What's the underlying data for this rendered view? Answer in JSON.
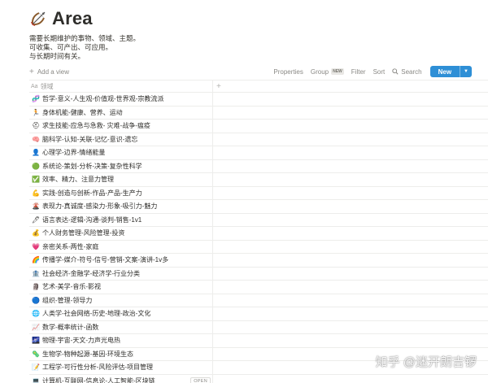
{
  "page": {
    "title": "Area",
    "title_icon": "bow-and-arrow-icon",
    "description": [
      "需要长期维护的事物、领域、主题。",
      "可收集、可产出、可应用。",
      "与长期时间有关。"
    ]
  },
  "toolbar": {
    "add_view": "Add a view",
    "properties": "Properties",
    "group": "Group",
    "group_badge": "NEW",
    "filter": "Filter",
    "sort": "Sort",
    "search": "Search",
    "new_label": "New",
    "accent": "#2e8fd6"
  },
  "table": {
    "column_header": "领域",
    "add_column": "+",
    "open_label": "OPEN",
    "rows": [
      {
        "icon": "🧬",
        "label": "哲学-意义-人生观-价值观-世界观-宗教流派"
      },
      {
        "icon": "🏃",
        "label": "身体机能-健康、营养、运动"
      },
      {
        "icon": "⛑",
        "label": "求生技能-应急与急救- 灾难-战争-瘟疫"
      },
      {
        "icon": "🧠",
        "label": "脑科学-认知-关联-记忆-意识-遗忘"
      },
      {
        "icon": "👤",
        "label": "心理学-边界-情绪能量"
      },
      {
        "icon": "🟢",
        "label": "系统论-策划-分析-决策-复杂性科学"
      },
      {
        "icon": "✅",
        "label": "效率、精力、注意力管理"
      },
      {
        "icon": "💪",
        "label": "实践-创造与创新-作品-产品-生产力"
      },
      {
        "icon": "🌋",
        "label": "表现力-真诚度-感染力-形象-吸引力-魅力"
      },
      {
        "icon": "🖊",
        "label": "语言表达-逻辑-沟通-谈判-销售-1v1"
      },
      {
        "icon": "💰",
        "label": "个人财务管理-风险管理-投资"
      },
      {
        "icon": "💗",
        "label": "亲密关系-两性-家庭"
      },
      {
        "icon": "🌈",
        "label": "传播学-媒介-符号-信号-营销-文案-演讲-1v多"
      },
      {
        "icon": "🏦",
        "label": "社会经济-金融学-经济学-行业分类"
      },
      {
        "icon": "🗿",
        "label": "艺术-美学-音乐-影视"
      },
      {
        "icon": "🔵",
        "label": "组织-管理-领导力"
      },
      {
        "icon": "🌐",
        "label": "人类学-社会网络-历史-地理-政治-文化"
      },
      {
        "icon": "📈",
        "label": "数学-概率统计-函数"
      },
      {
        "icon": "🌌",
        "label": "物理-宇宙-天文-力声光电热"
      },
      {
        "icon": "🦠",
        "label": "生物学-物种起源-基因-环境生态"
      },
      {
        "icon": "📝",
        "label": "工程学-可行性分析-风险评估-项目管理"
      },
      {
        "icon": "💻",
        "label": "计算机-互联网-信息论-人工智能-区块链"
      }
    ]
  },
  "watermark": "知乎 @迷开朗吉锣"
}
